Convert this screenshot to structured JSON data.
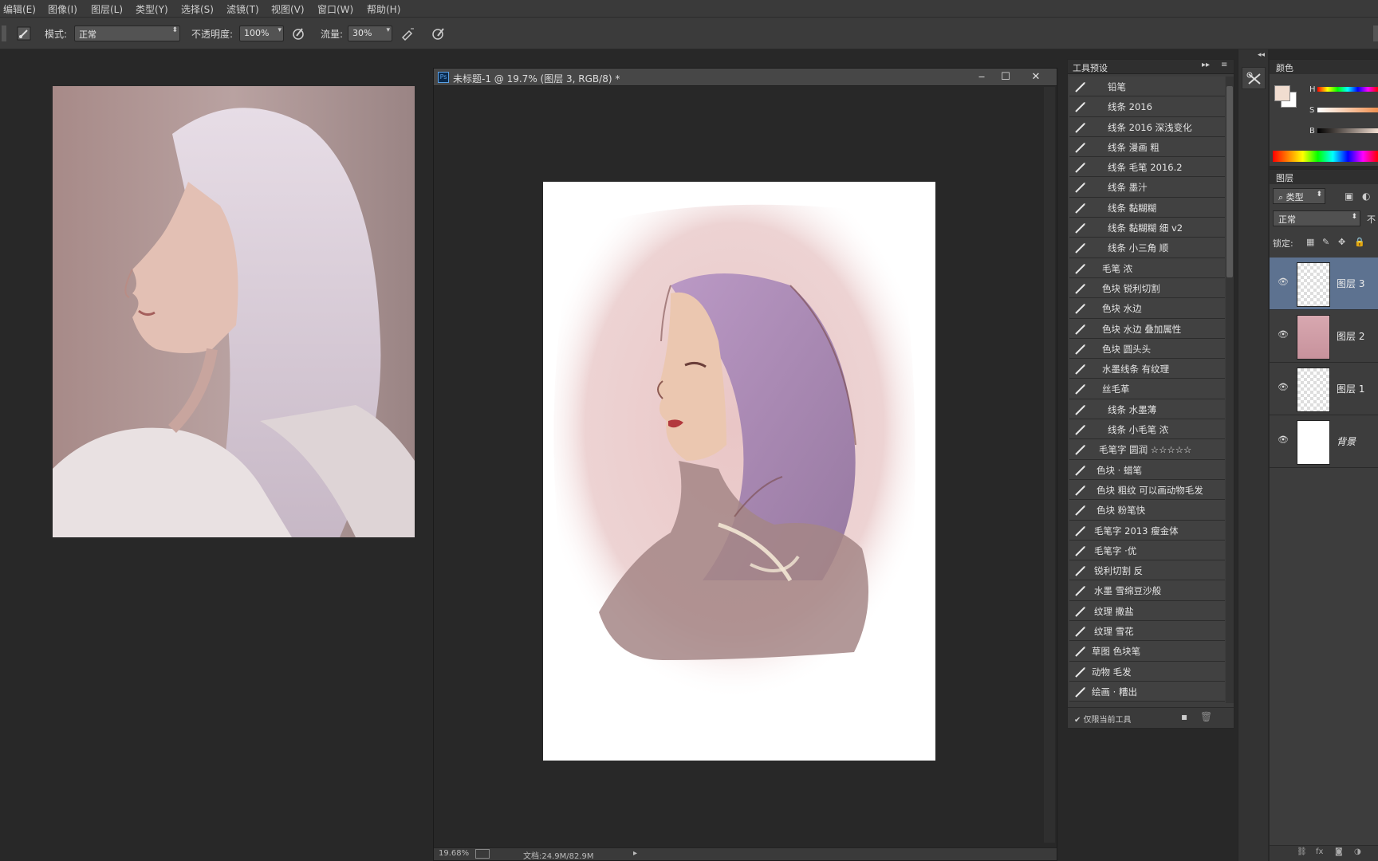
{
  "menu": [
    "编辑(E)",
    "图像(I)",
    "图层(L)",
    "类型(Y)",
    "选择(S)",
    "滤镜(T)",
    "视图(V)",
    "窗口(W)",
    "帮助(H)"
  ],
  "options": {
    "mode_label": "模式:",
    "mode_value": "正常",
    "opacity_label": "不透明度:",
    "opacity_value": "100%",
    "flow_label": "流量:",
    "flow_value": "30%"
  },
  "document": {
    "title": "未标题-1 @ 19.7% (图层 3, RGB/8) *",
    "ps_badge": "Ps",
    "zoom": "19.68%",
    "doc_info": "文档:24.9M/82.9M"
  },
  "presets": {
    "tab": "工具预设",
    "items": [
      "铅笔",
      "线条 2016",
      "线条 2016 深浅变化",
      "线条 漫画 粗",
      "线条 毛笔 2016.2",
      "线条 墨汁",
      "线条 黏糊糊",
      "线条 黏糊糊 细 v2",
      "线条 小三角 顺",
      "毛笔 浓",
      "色块 锐利切割",
      "色块 水边",
      "色块 水边 叠加属性",
      "色块 圆头头",
      "水墨线条 有纹理",
      "丝毛革",
      "线条 水墨薄",
      "线条 小毛笔 浓",
      "毛笔字 圆润 ☆☆☆☆☆",
      "色块 · 蜡笔",
      "色块 粗纹 可以画动物毛发",
      "色块 粉笔快",
      "毛笔字 2013 瘦金体",
      "毛笔字 ·优",
      "锐利切割 反",
      "水墨 雪绵豆沙般",
      "纹理 撒盐",
      "纹理 雪花",
      "草图 色块笔",
      "动物 毛发",
      "绘画 · 糟出"
    ],
    "footer_checkbox": "仅限当前工具"
  },
  "color_panel": {
    "tab": "颜色",
    "h_label": "H",
    "s_label": "S",
    "b_label": "B",
    "foreground": "#f1ddd0",
    "background": "#ffffff"
  },
  "layers_panel": {
    "tab": "图层",
    "filter_value": "类型",
    "blend_value": "正常",
    "opacity_prefix": "不",
    "lock_label": "锁定:",
    "layers": [
      {
        "name": "图层 3",
        "selected": true
      },
      {
        "name": "图层 2",
        "selected": false
      },
      {
        "name": "图层 1",
        "selected": false
      },
      {
        "name": "背景",
        "selected": false
      }
    ]
  },
  "colors": {
    "selection_blue": "#5d7290",
    "panel_bg": "#3d3d3d",
    "app_bg": "#282828"
  }
}
